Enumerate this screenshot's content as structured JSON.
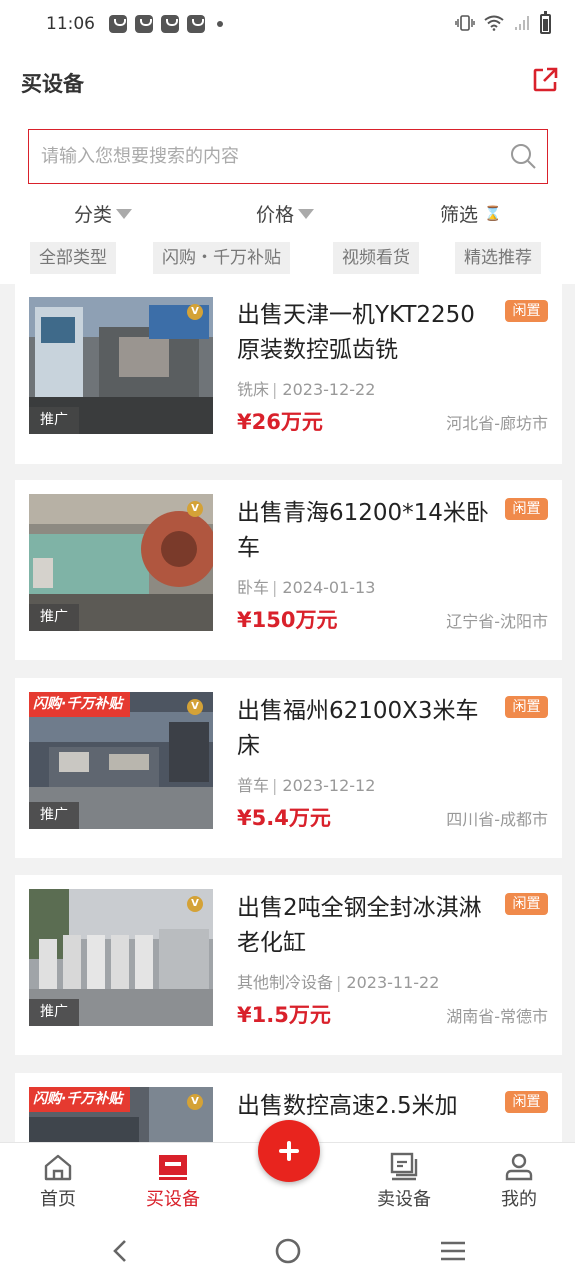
{
  "status": {
    "time": "11:06"
  },
  "header": {
    "title": "买设备",
    "search_placeholder": "请输入您想要搜索的内容"
  },
  "filters": [
    {
      "label": "分类"
    },
    {
      "label": "价格"
    },
    {
      "label": "筛选"
    }
  ],
  "tags": [
    "全部类型",
    "闪购・千万补贴",
    "视频看货",
    "精选推荐"
  ],
  "listings": [
    {
      "title": "出售天津一机YKT2250原装数控弧齿铣",
      "category": "铣床",
      "date": "2023-12-22",
      "price": "¥26万元",
      "location": "河北省-廊坊市",
      "badge": "闲置",
      "promo": "推广",
      "flash": ""
    },
    {
      "title": "出售青海61200*14米卧车",
      "category": "卧车",
      "date": "2024-01-13",
      "price": "¥150万元",
      "location": "辽宁省-沈阳市",
      "badge": "闲置",
      "promo": "推广",
      "flash": ""
    },
    {
      "title": "出售福州62100X3米车床",
      "category": "普车",
      "date": "2023-12-12",
      "price": "¥5.4万元",
      "location": "四川省-成都市",
      "badge": "闲置",
      "promo": "推广",
      "flash": "闪购·千万补贴"
    },
    {
      "title": "出售2吨全钢全封冰淇淋老化缸",
      "category": "其他制冷设备",
      "date": "2023-11-22",
      "price": "¥1.5万元",
      "location": "湖南省-常德市",
      "badge": "闲置",
      "promo": "推广",
      "flash": ""
    },
    {
      "title": "出售数控高速2.5米加",
      "category": "",
      "date": "",
      "price": "",
      "location": "",
      "badge": "闲置",
      "promo": "",
      "flash": "闪购·千万补贴"
    }
  ],
  "tabbar": {
    "items": [
      {
        "label": "首页",
        "icon": "home-icon"
      },
      {
        "label": "买设备",
        "icon": "buy-equipment-icon",
        "active": true
      },
      {
        "label": "卖设备",
        "icon": "sell-equipment-icon"
      },
      {
        "label": "我的",
        "icon": "profile-icon"
      }
    ],
    "fab_icon": "plus-icon"
  },
  "colors": {
    "accent": "#d9212b",
    "idle_badge": "#f08a4b",
    "flash_tag": "#e53a30"
  }
}
